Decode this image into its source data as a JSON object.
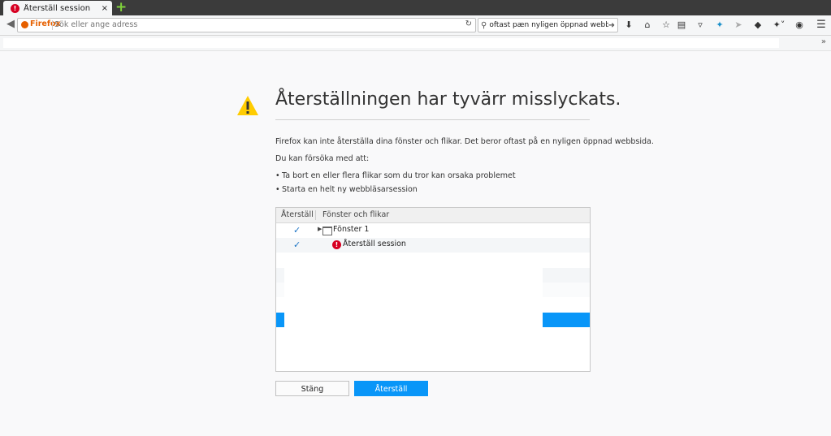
{
  "tab": {
    "title": "Återställ session",
    "close": "×",
    "new_tab": "+"
  },
  "navbar": {
    "brand": "Firefox",
    "url_placeholder": "Sök eller ange adress",
    "search_text": "oftast pæn nyligen öppnad webbsida."
  },
  "page": {
    "heading": "Återställningen har tyvärr misslyckats.",
    "description": "Firefox kan inte återställa dina fönster och flikar. Det beror oftast på en nyligen öppnad webbsida.",
    "try_intro": "Du kan försöka med att:",
    "suggestions": [
      "Ta bort en eller flera flikar som du tror kan orsaka problemet",
      "Starta en helt ny webbläsarsession"
    ]
  },
  "tree": {
    "columns": [
      "Återställ",
      "Fönster och flikar"
    ],
    "rows": [
      {
        "checked": true,
        "label": "Fönster 1"
      },
      {
        "checked": true,
        "label": "Återställ session"
      }
    ]
  },
  "buttons": {
    "close": "Stäng",
    "restore": "Återställ"
  },
  "colors": {
    "accent": "#0996f8",
    "error": "#d70022",
    "warning": "#ffcc00"
  }
}
